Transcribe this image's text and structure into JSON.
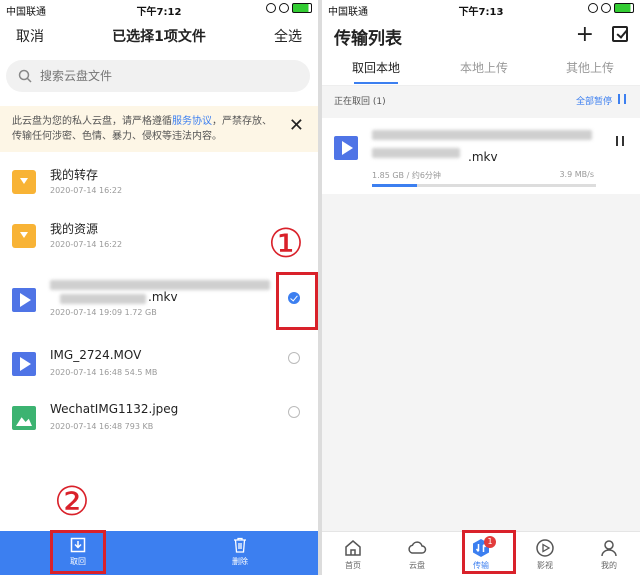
{
  "left": {
    "status": {
      "carrier": "中国联通",
      "time": "下午7:12"
    },
    "header": {
      "cancel": "取消",
      "title": "已选择1项文件",
      "select_all": "全选"
    },
    "search": {
      "placeholder": "搜索云盘文件"
    },
    "notice": {
      "text1": "此云盘为您的私人云盘，请严格遵循",
      "link": "服务协议",
      "text2": "，严禁存放、传输任何涉密、色情、暴力、侵权等违法内容。"
    },
    "files": [
      {
        "name": "我的转存",
        "meta": "2020-07-14 16:22",
        "icon": "folder-icon",
        "selected": false
      },
      {
        "name": "我的资源",
        "meta": "2020-07-14 16:22",
        "icon": "folder-icon",
        "selected": false
      },
      {
        "name": ".mkv",
        "meta": "2020-07-14 19:09  1.72 GB",
        "icon": "video-icon",
        "selected": true
      },
      {
        "name": "IMG_2724.MOV",
        "meta": "2020-07-14 16:48  54.5 MB",
        "icon": "video-icon",
        "selected": false
      },
      {
        "name": "WechatIMG1132.jpeg",
        "meta": "2020-07-14 16:48  793 KB",
        "icon": "image-icon",
        "selected": false
      }
    ],
    "annotations": {
      "one": "①",
      "two": "②"
    },
    "bottom": {
      "retrieve": "取回",
      "delete": "删除"
    }
  },
  "right": {
    "status": {
      "carrier": "中国联通",
      "time": "下午7:13"
    },
    "header": {
      "title": "传输列表"
    },
    "tabs": [
      "取回本地",
      "本地上传",
      "其他上传"
    ],
    "section": {
      "label": "正在取回 (1)",
      "action": "全部暂停"
    },
    "task": {
      "name": ".mkv",
      "progress_text": "1.85 GB / 约6分钟",
      "speed": "3.9 MB/s",
      "progress": 0.2
    },
    "tabbar": [
      "首页",
      "云盘",
      "传输",
      "影视",
      "我的"
    ],
    "badge": "1"
  }
}
